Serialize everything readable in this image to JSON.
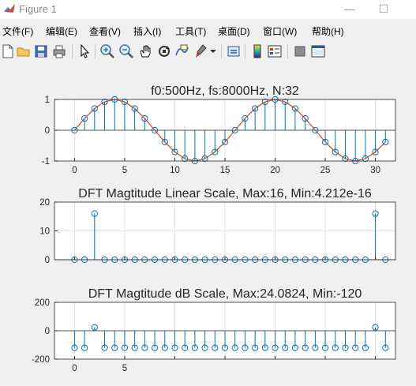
{
  "window": {
    "title": "Figure 1",
    "minimize": "—",
    "maximize": "☐"
  },
  "menu": [
    {
      "label": "文件(F)"
    },
    {
      "label": "编辑(E)"
    },
    {
      "label": "查看(V)"
    },
    {
      "label": "插入(I)"
    },
    {
      "label": "工具(T)"
    },
    {
      "label": "桌面(D)"
    },
    {
      "label": "窗口(W)"
    },
    {
      "label": "帮助(H)"
    }
  ],
  "toolbar": [
    "new-figure-icon",
    "open-file-icon",
    "save-icon",
    "print-icon",
    "edit-plot-icon",
    "zoom-in-icon",
    "zoom-out-icon",
    "pan-icon",
    "rotate-3d-icon",
    "data-cursor-icon",
    "brush-icon",
    "link-plot-icon",
    "insert-colorbar-icon",
    "insert-legend-icon",
    "hide-plot-tools-icon",
    "show-plot-tools-icon"
  ],
  "colors": {
    "stem": "#0072BD",
    "line": "#D95319",
    "axes_bg": "#ffffff",
    "figure_bg": "#f0f0f0"
  },
  "chart_data": [
    {
      "type": "line",
      "title": "f0:500Hz, fs:8000Hz, N:32",
      "xlim": [
        -2,
        32
      ],
      "ylim": [
        -1,
        1
      ],
      "xticks": [
        0,
        5,
        10,
        15,
        20,
        25,
        30
      ],
      "yticks": [
        -1,
        0,
        1
      ],
      "xticklabels": [
        "0",
        "5",
        "10",
        "15",
        "20",
        "25",
        "30"
      ],
      "yticklabels": [
        "-1",
        "0",
        "1"
      ],
      "grid": true,
      "n": [
        0,
        1,
        2,
        3,
        4,
        5,
        6,
        7,
        8,
        9,
        10,
        11,
        12,
        13,
        14,
        15,
        16,
        17,
        18,
        19,
        20,
        21,
        22,
        23,
        24,
        25,
        26,
        27,
        28,
        29,
        30,
        31
      ],
      "series": [
        {
          "style": "stem",
          "values": [
            0,
            0.383,
            0.707,
            0.924,
            1,
            0.924,
            0.707,
            0.383,
            0,
            -0.383,
            -0.707,
            -0.924,
            -1,
            -0.924,
            -0.707,
            -0.383,
            0,
            0.383,
            0.707,
            0.924,
            1,
            0.924,
            0.707,
            0.383,
            0,
            -0.383,
            -0.707,
            -0.924,
            -1,
            -0.924,
            -0.707,
            -0.383
          ]
        },
        {
          "style": "line",
          "values": [
            0,
            0.383,
            0.707,
            0.924,
            1,
            0.924,
            0.707,
            0.383,
            0,
            -0.383,
            -0.707,
            -0.924,
            -1,
            -0.924,
            -0.707,
            -0.383,
            0,
            0.383,
            0.707,
            0.924,
            1,
            0.924,
            0.707,
            0.383,
            0,
            -0.383,
            -0.707,
            -0.924,
            -1,
            -0.924,
            -0.707,
            -0.383
          ]
        }
      ]
    },
    {
      "type": "stem",
      "title": "DFT Magtitude Linear Scale,  Max:16, Min:4.212e-16",
      "xlim": [
        -2,
        32
      ],
      "ylim": [
        0,
        20
      ],
      "xticks": [
        0,
        5,
        10,
        15,
        20,
        25,
        30
      ],
      "yticks": [
        0,
        10,
        20
      ],
      "yticklabels": [
        "0",
        "10",
        "20"
      ],
      "grid": true,
      "n": [
        0,
        1,
        2,
        3,
        4,
        5,
        6,
        7,
        8,
        9,
        10,
        11,
        12,
        13,
        14,
        15,
        16,
        17,
        18,
        19,
        20,
        21,
        22,
        23,
        24,
        25,
        26,
        27,
        28,
        29,
        30,
        31
      ],
      "values": [
        0,
        0,
        16,
        0,
        0,
        0,
        0,
        0,
        0,
        0,
        0,
        0,
        0,
        0,
        0,
        0,
        0,
        0,
        0,
        0,
        0,
        0,
        0,
        0,
        0,
        0,
        0,
        0,
        0,
        0,
        16,
        0
      ]
    },
    {
      "type": "stem",
      "title": "DFT Magtitude dB Scale,  Max:24.0824, Min:-120",
      "xlim": [
        -2,
        32
      ],
      "ylim": [
        -200,
        200
      ],
      "xticks": [
        0,
        5,
        10,
        15,
        20,
        25,
        30
      ],
      "yticks": [
        -200,
        0,
        200
      ],
      "yticklabels": [
        "-200",
        "0",
        "200"
      ],
      "xticklabels": [
        "0",
        "5",
        "",
        "",
        "",
        "",
        ""
      ],
      "grid": true,
      "n": [
        0,
        1,
        2,
        3,
        4,
        5,
        6,
        7,
        8,
        9,
        10,
        11,
        12,
        13,
        14,
        15,
        16,
        17,
        18,
        19,
        20,
        21,
        22,
        23,
        24,
        25,
        26,
        27,
        28,
        29,
        30,
        31
      ],
      "values": [
        -120,
        -120,
        24.08,
        -120,
        -120,
        -120,
        -120,
        -120,
        -120,
        -120,
        -120,
        -120,
        -120,
        -120,
        -120,
        -120,
        -120,
        -120,
        -120,
        -120,
        -120,
        -120,
        -120,
        -120,
        -120,
        -120,
        -120,
        -120,
        -120,
        -120,
        24.08,
        -120
      ]
    }
  ]
}
